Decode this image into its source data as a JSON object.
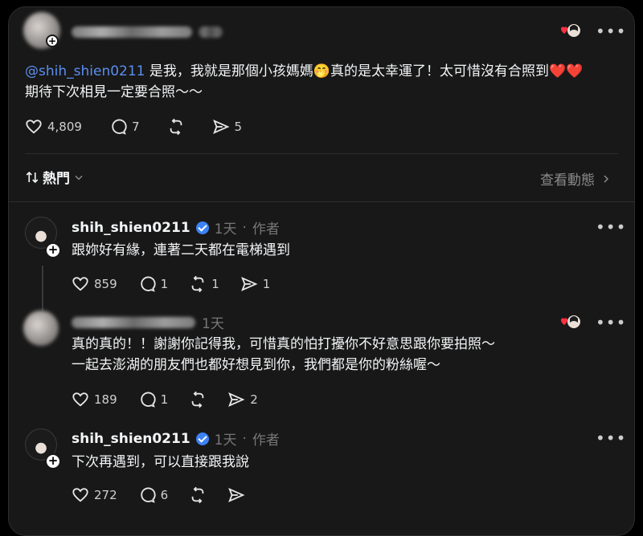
{
  "post": {
    "username_label": "shih_shien0211",
    "mention": "@shih_shien0211",
    "text_line1": " 是我，我就是那個小孩媽媽🤭真的是太幸運了！太可惜沒有合照到❤️❤️",
    "text_line2": "期待下次相見一定要合照～～",
    "likes": "4,809",
    "comments": "7",
    "shares": "5"
  },
  "sort": {
    "label": "熱門",
    "view_activity": "查看動態"
  },
  "replies": [
    {
      "username": "shih_shien0211",
      "time": "1天",
      "author_tag": "作者",
      "text": "跟妳好有緣，連著二天都在電梯遇到",
      "likes": "859",
      "comments": "1",
      "reposts": "1",
      "shares": "1"
    },
    {
      "time": "1天",
      "text_line1": "真的真的！！謝謝你記得我，可惜真的怕打擾你不好意思跟你要拍照～",
      "text_line2": "一起去澎湖的朋友們也都好想見到你，我們都是你的粉絲喔～",
      "likes": "189",
      "comments": "1",
      "shares": "2"
    },
    {
      "username": "shih_shien0211",
      "time": "1天",
      "author_tag": "作者",
      "text": "下次再遇到，可以直接跟我說",
      "likes": "272",
      "comments": "6"
    }
  ],
  "colors": {
    "background": "#000000",
    "panel": "#181818",
    "mention": "#5b8ef0",
    "verified": "#3b82f6",
    "heart": "#ff3040"
  },
  "icons": [
    "heart-icon",
    "comment-icon",
    "repost-icon",
    "share-icon",
    "more-icon",
    "sort-icon",
    "chevron-down-icon",
    "chevron-right-icon",
    "verified-icon",
    "plus-icon"
  ]
}
